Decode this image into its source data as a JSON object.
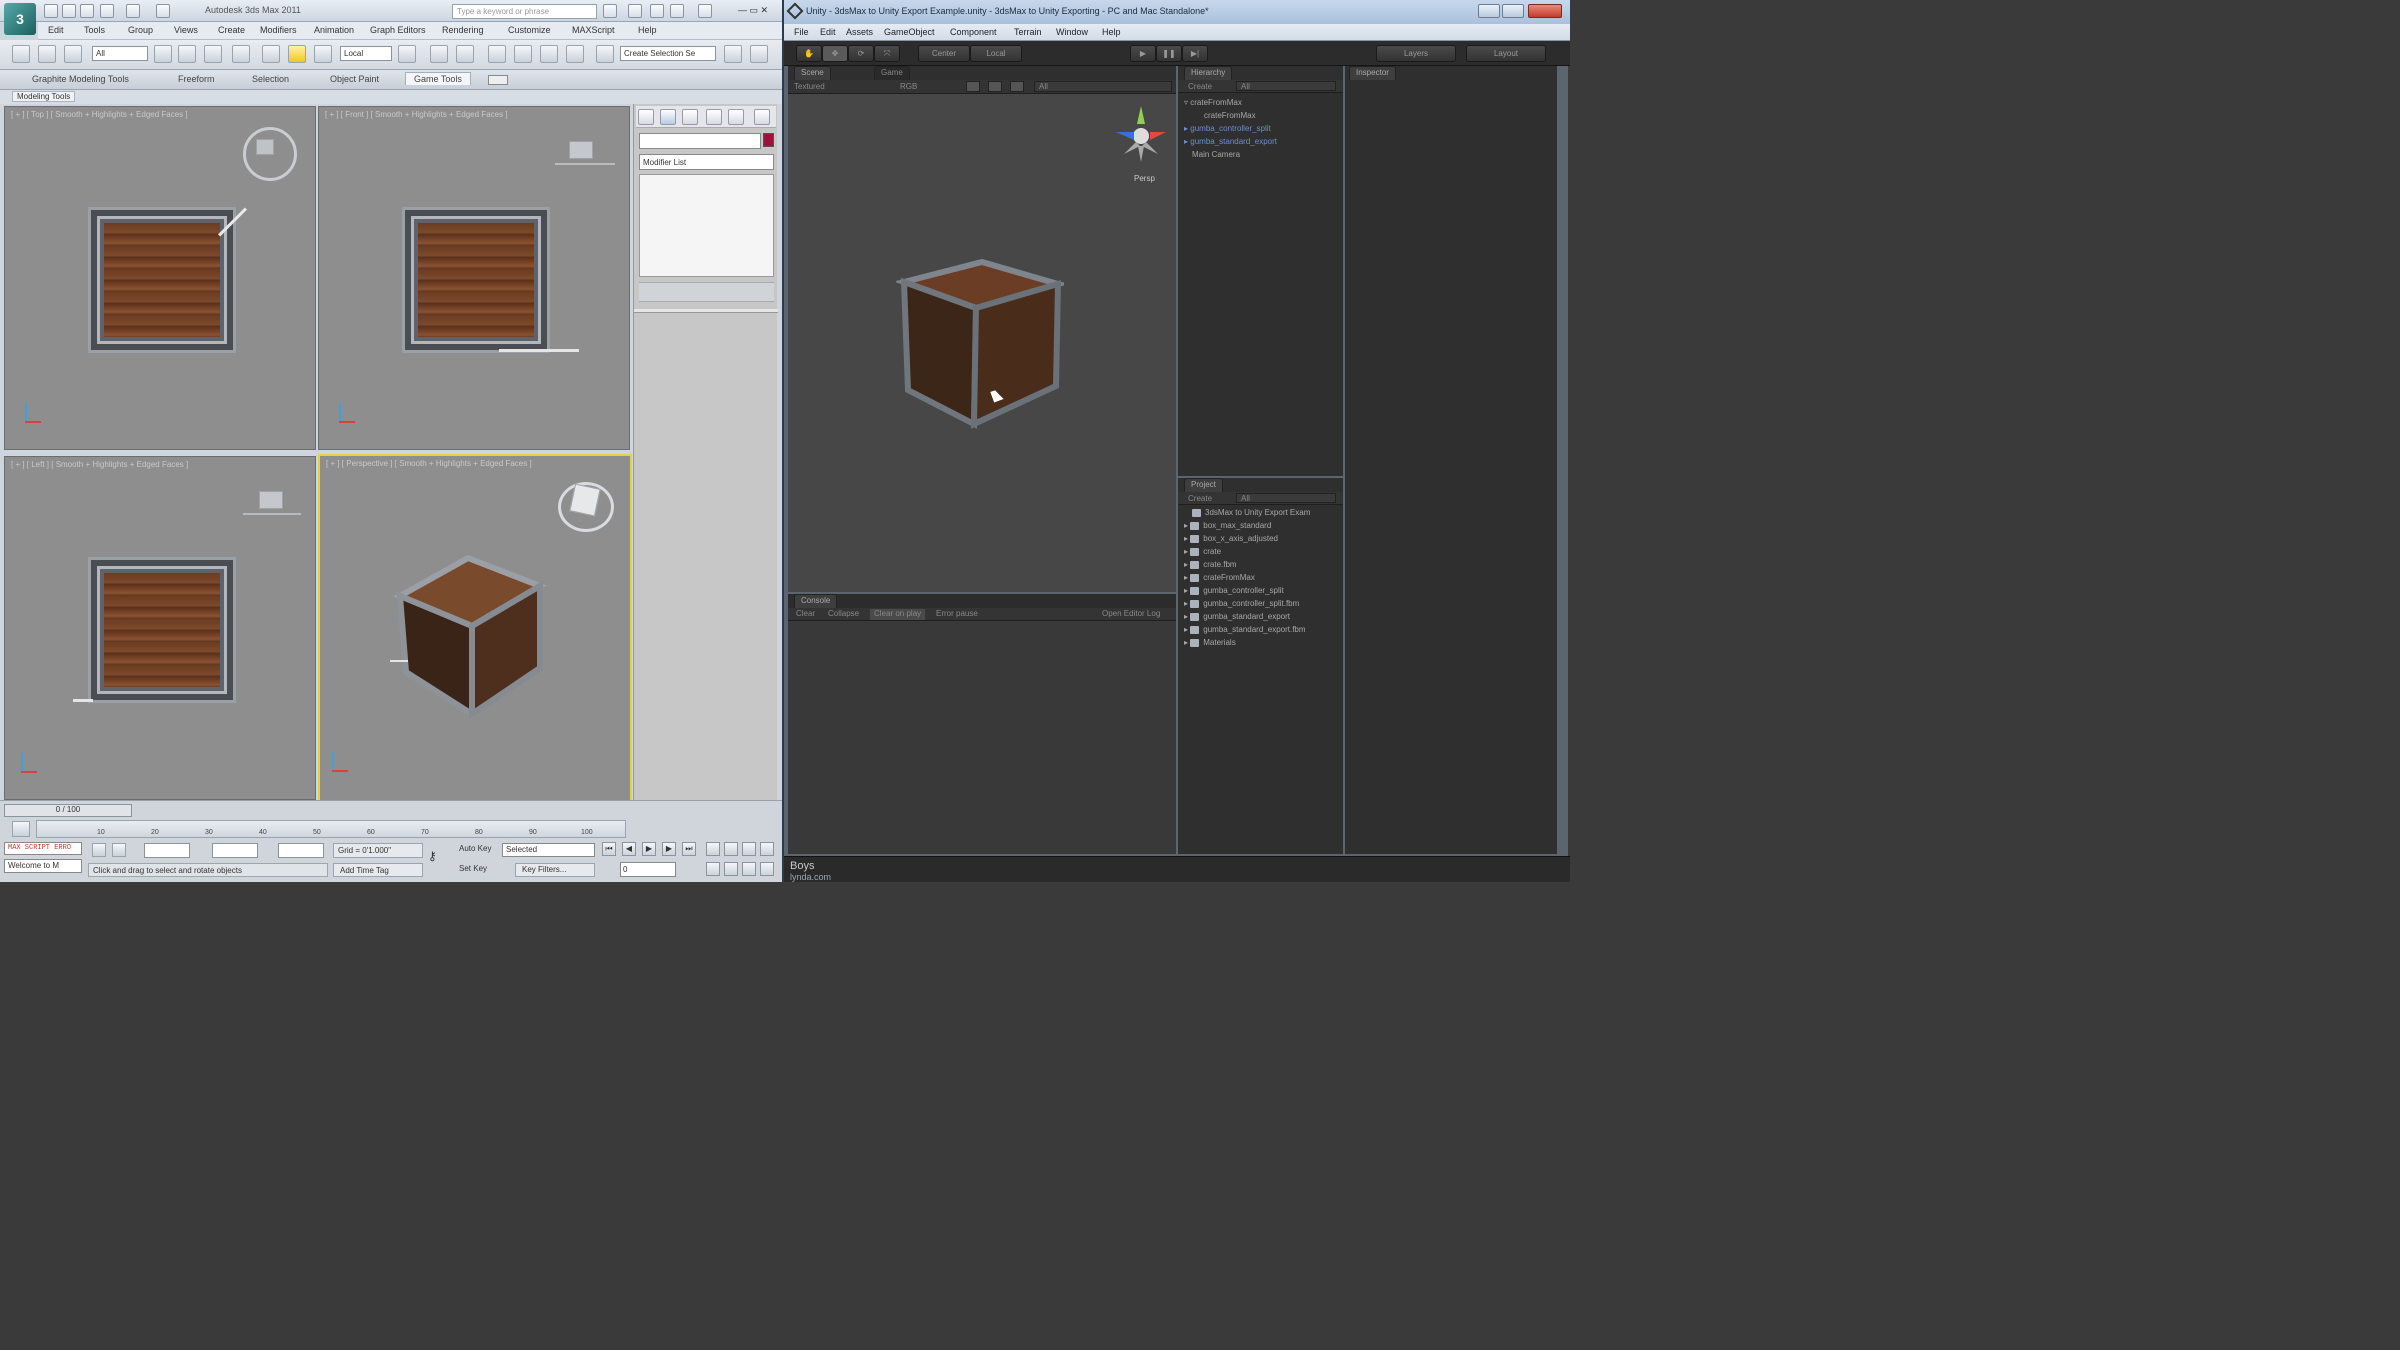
{
  "max": {
    "app_title": "Autodesk 3ds Max 2011",
    "search_placeholder": "Type a keyword or phrase",
    "menu": [
      "Edit",
      "Tools",
      "Group",
      "Views",
      "Create",
      "Modifiers",
      "Animation",
      "Graph Editors",
      "Rendering",
      "Customize",
      "MAXScript",
      "Help"
    ],
    "selection_filter": "All",
    "ref_coord": "Local",
    "named_selection_placeholder": "Create Selection Se",
    "ribbon_tabs": [
      "Graphite Modeling Tools",
      "Freeform",
      "Selection",
      "Object Paint",
      "Game Tools"
    ],
    "active_ribbon_tab": "Game Tools",
    "sub_tab": "Modeling Tools",
    "viewports": [
      {
        "label": "[ + ] [ Top ] [ Smooth + Highlights + Edged Faces ]"
      },
      {
        "label": "[ + ] [ Front ] [ Smooth + Highlights + Edged Faces ]"
      },
      {
        "label": "[ + ] [ Left ] [ Smooth + Highlights + Edged Faces ]"
      },
      {
        "label": "[ + ] [ Perspective ] [ Smooth + Highlights + Edged Faces ]"
      }
    ],
    "modifier_list": "Modifier List",
    "time_slider": "0 / 100",
    "timeline_ticks": [
      "10",
      "20",
      "30",
      "40",
      "50",
      "60",
      "70",
      "80",
      "90",
      "100"
    ],
    "maxscript_text": "MAX SCRIPT ERRO",
    "welcome": "Welcome to M",
    "status_prompt": "Click and drag to select and rotate objects",
    "grid": "Grid = 0'1.000\"",
    "add_time_tag": "Add Time Tag",
    "auto_key": "Auto Key",
    "set_key": "Set Key",
    "key_mode": "Selected",
    "key_filters": "Key Filters...",
    "frame": "0"
  },
  "unity": {
    "title": "Unity - 3dsMax to Unity Export Example.unity - 3dsMax to Unity Exporting - PC and Mac Standalone*",
    "menu": [
      "File",
      "Edit",
      "Assets",
      "GameObject",
      "Component",
      "Terrain",
      "Window",
      "Help"
    ],
    "pivot_mode": "Center",
    "pivot_space": "Local",
    "layers": "Layers",
    "layout": "Layout",
    "scene_tab": "Scene",
    "game_tab": "Game",
    "scene_shading": "Textured",
    "scene_rgb": "RGB",
    "scene_search": "All",
    "persp_label": "Persp",
    "console_tab": "Console",
    "console_buttons": [
      "Clear",
      "Collapse",
      "Clear on play",
      "Error pause"
    ],
    "console_open_log": "Open Editor Log",
    "hierarchy_tab": "Hierarchy",
    "create_label": "Create",
    "hierarchy_search": "All",
    "hierarchy_items": [
      {
        "name": "crateFromMax",
        "indent": 0,
        "blue": false
      },
      {
        "name": "crateFromMax",
        "indent": 1,
        "blue": false
      },
      {
        "name": "gumba_controller_split",
        "indent": 0,
        "blue": true
      },
      {
        "name": "gumba_standard_export",
        "indent": 0,
        "blue": true
      },
      {
        "name": "Main Camera",
        "indent": 0,
        "blue": false
      }
    ],
    "project_tab": "Project",
    "project_search": "All",
    "project_items": [
      "3dsMax to Unity Export Exam",
      "box_max_standard",
      "box_x_axis_adjusted",
      "crate",
      "crate.fbm",
      "crateFromMax",
      "gumba_controller_split",
      "gumba_controller_split.fbm",
      "gumba_standard_export",
      "gumba_standard_export.fbm",
      "Materials"
    ],
    "inspector_tab": "Inspector",
    "status_text": "Boys"
  },
  "watermark": "lynda.com",
  "colors": {
    "active_viewport_border": "#e3d538",
    "unity_dark": "#2f2f2f",
    "max_bg": "#cfd5dc",
    "hierarchy_prefab_blue": "#6a8fd0"
  }
}
